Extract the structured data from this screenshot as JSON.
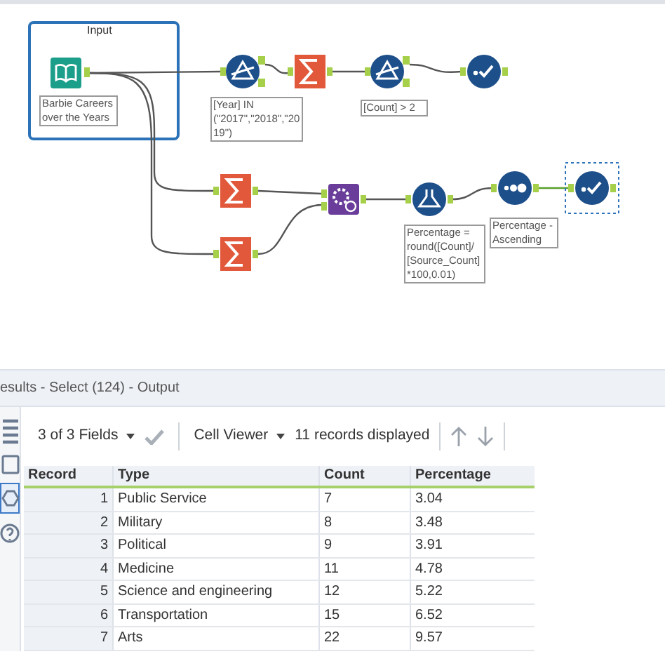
{
  "workflow": {
    "container": {
      "title": "Input"
    },
    "nodes": [
      {
        "kind": "input",
        "label": "Barbie Careers over the Years",
        "selected": false
      },
      {
        "kind": "filter",
        "label": "[Year] IN (\"2017\",\"2018\",\"2019\")",
        "selected": false
      },
      {
        "kind": "summarize",
        "selected": false
      },
      {
        "kind": "filter",
        "label": "[Count] > 2",
        "selected": false
      },
      {
        "kind": "browse",
        "selected": false
      },
      {
        "kind": "summarize",
        "selected": false
      },
      {
        "kind": "summarize",
        "selected": false
      },
      {
        "kind": "append",
        "selected": false
      },
      {
        "kind": "formula",
        "label": "Percentage = round([Count]/ [Source_Count] *100,0.01)",
        "selected": false
      },
      {
        "kind": "sort",
        "label": "Percentage - Ascending",
        "selected": false
      },
      {
        "kind": "browse",
        "selected": true
      }
    ]
  },
  "results": {
    "title": "esults - Select (124) - Output",
    "toolbar": {
      "fields": "3 of 3 Fields",
      "viewer": "Cell Viewer",
      "records": "11 records displayed"
    },
    "table": {
      "columns": [
        "Record",
        "Type",
        "Count",
        "Percentage"
      ],
      "rows": [
        [
          "1",
          "Public Service",
          "7",
          "3.04"
        ],
        [
          "2",
          "Military",
          "8",
          "3.48"
        ],
        [
          "3",
          "Political",
          "9",
          "3.91"
        ],
        [
          "4",
          "Medicine",
          "11",
          "4.78"
        ],
        [
          "5",
          "Science and engineering",
          "12",
          "5.22"
        ],
        [
          "6",
          "Transportation",
          "15",
          "6.52"
        ],
        [
          "7",
          "Arts",
          "22",
          "9.57"
        ]
      ]
    }
  }
}
